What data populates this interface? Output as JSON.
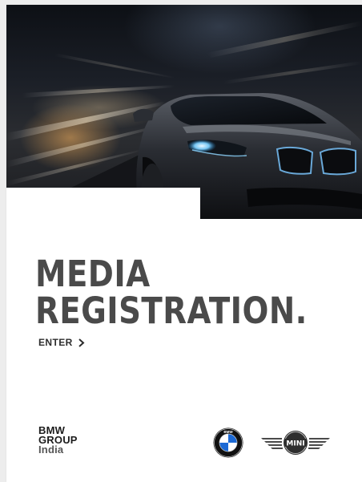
{
  "hero": {
    "icon": "car-photo"
  },
  "headline": {
    "line1": "MEDIA",
    "line2": "REGISTRATION."
  },
  "enter": {
    "label": "ENTER",
    "icon": "chevron-right-icon"
  },
  "footer": {
    "group_logo": {
      "line1": "BMW",
      "line2": "GROUP",
      "line3": "India"
    },
    "bmw_logo": {
      "letters": "BMW",
      "icon": "bmw-roundel-logo"
    },
    "mini_logo": {
      "text": "MINI",
      "icon": "mini-wings-logo"
    }
  },
  "colors": {
    "title": "#4a4a4a",
    "link": "#2c2c2c",
    "bmw_blue": "#1c69d4",
    "page_bg": "#ededed",
    "card_bg": "#ffffff"
  }
}
